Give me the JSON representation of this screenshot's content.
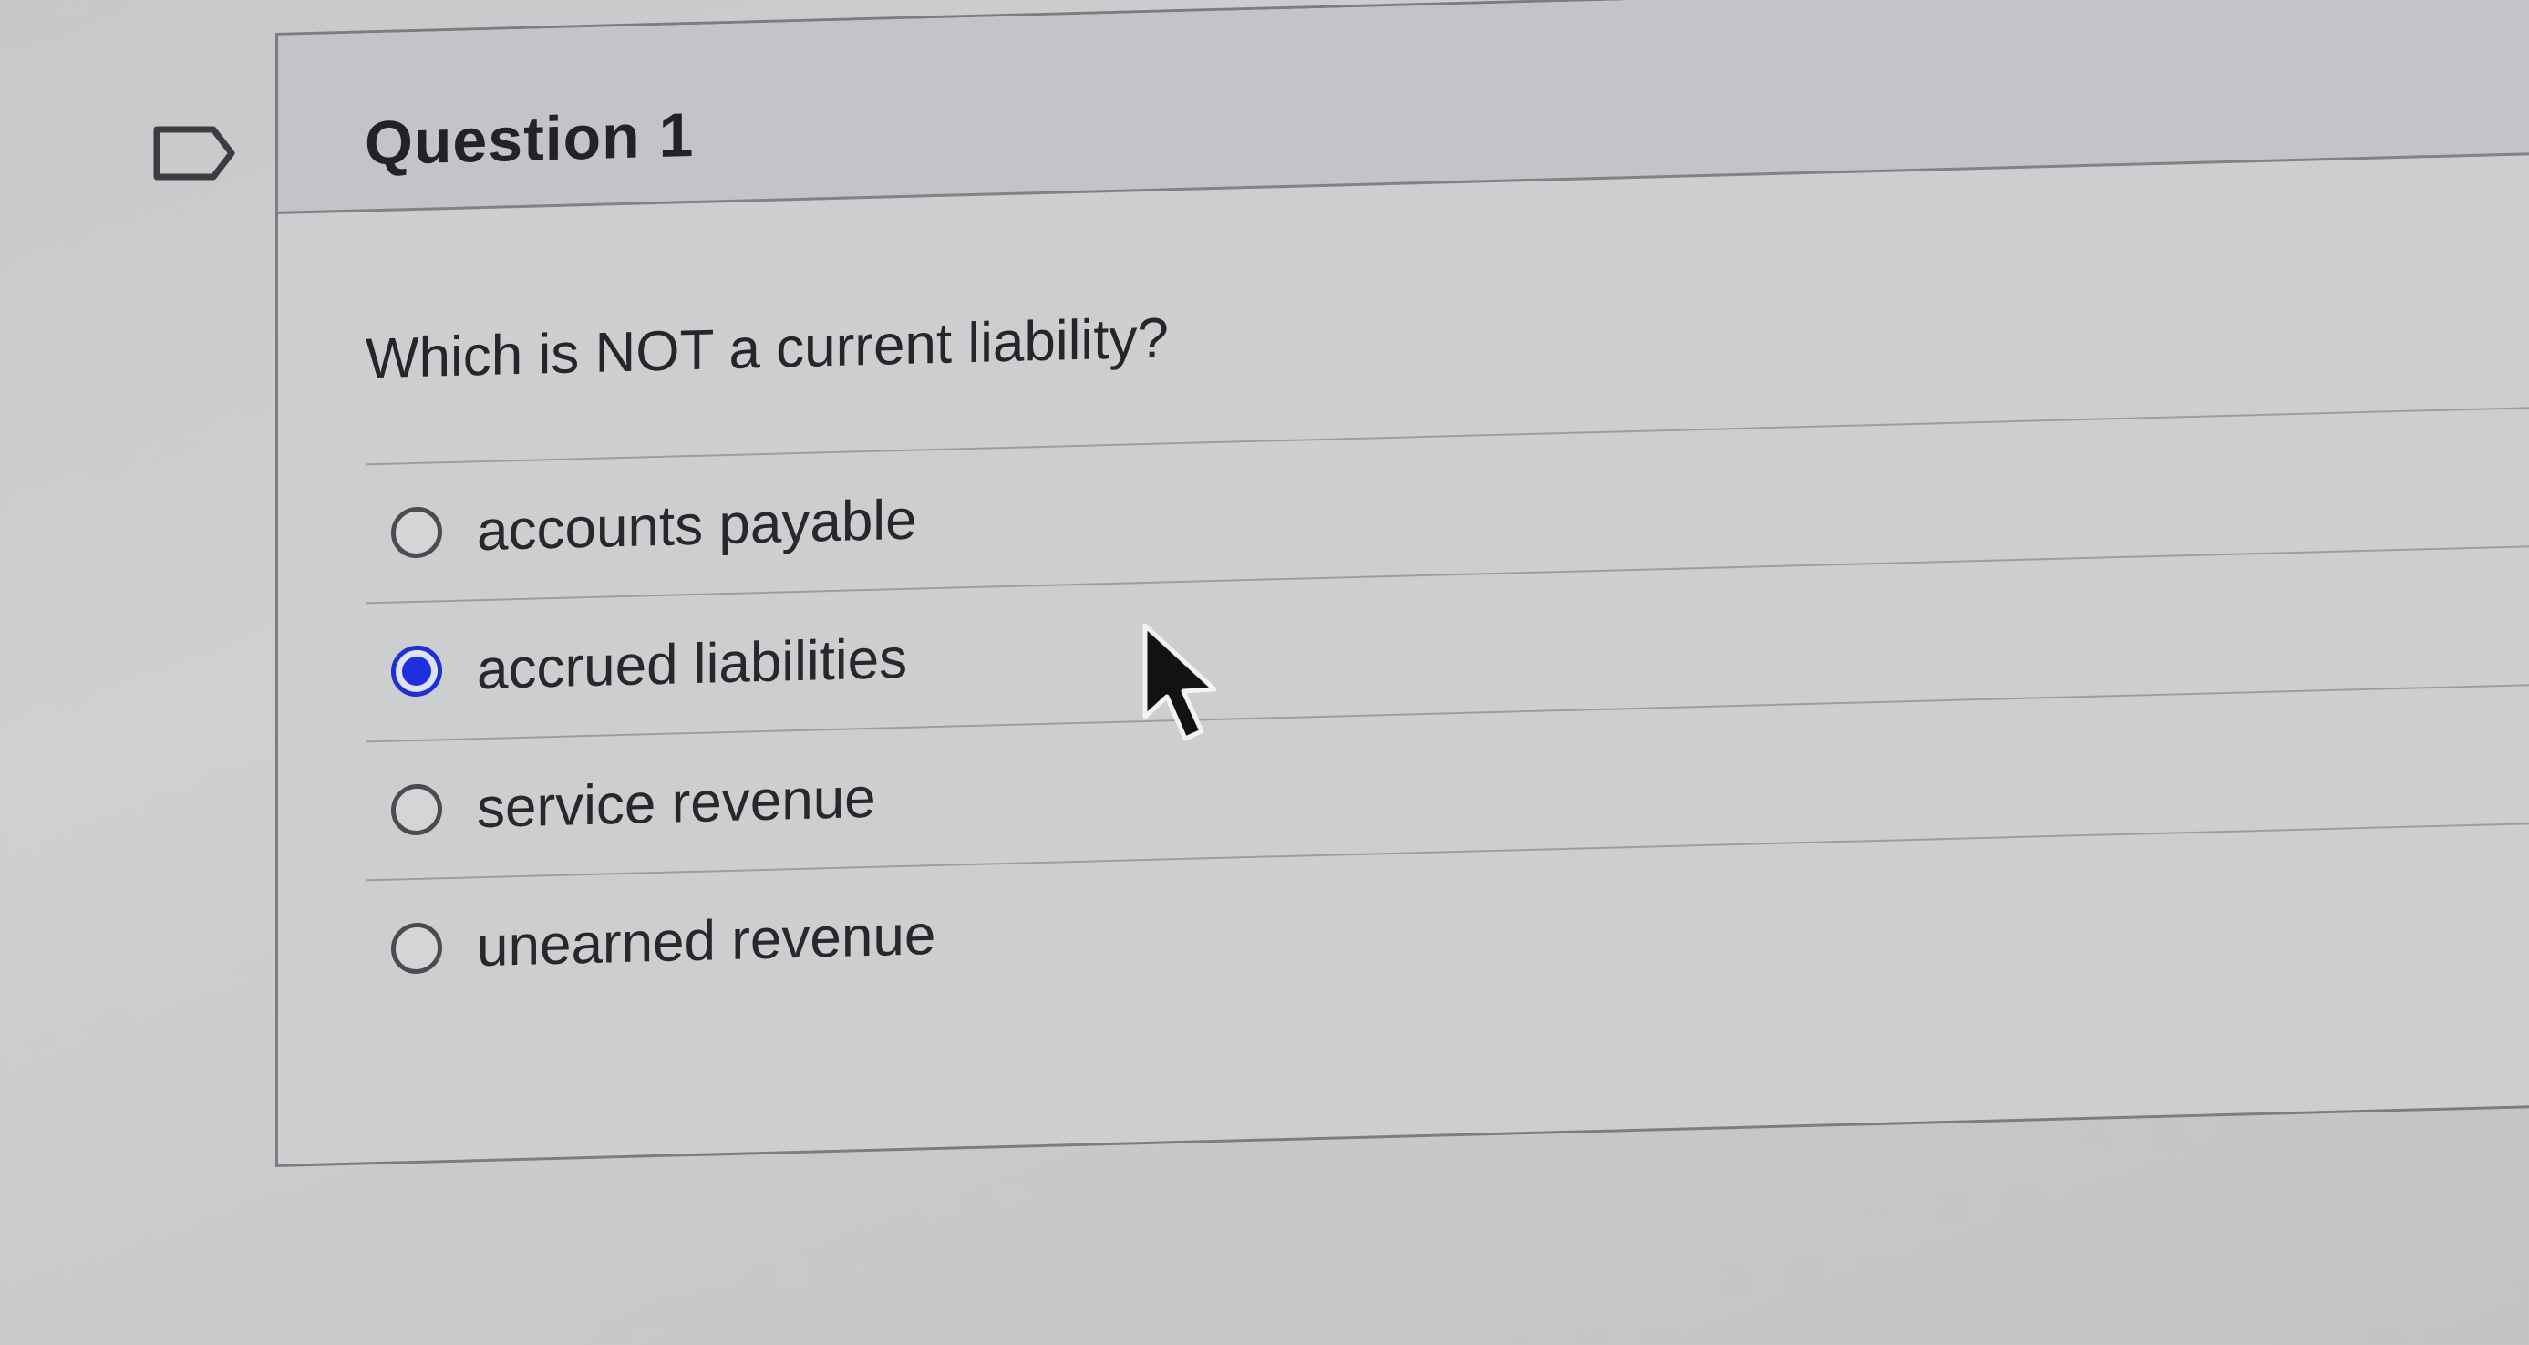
{
  "question": {
    "title": "Question 1",
    "prompt": "Which is NOT a current liability?",
    "options": [
      {
        "label": "accounts payable",
        "selected": false
      },
      {
        "label": "accrued liabilities",
        "selected": true
      },
      {
        "label": "service revenue",
        "selected": false
      },
      {
        "label": "unearned revenue",
        "selected": false
      }
    ],
    "selected_index": 1
  },
  "icons": {
    "flag": "flag-icon",
    "cursor": "mouse-pointer-icon"
  },
  "colors": {
    "accent": "#1f2fe0",
    "text": "#252629",
    "border": "#7c7d80"
  }
}
